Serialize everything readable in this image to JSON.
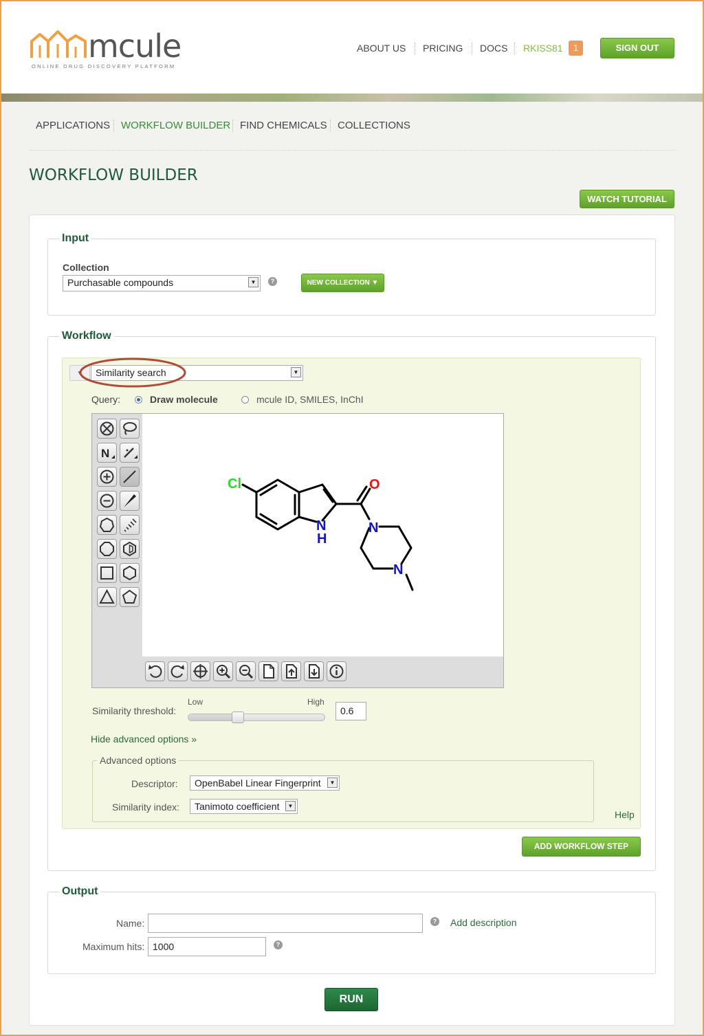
{
  "brand": {
    "name": "mcule",
    "tagline": "ONLINE DRUG DISCOVERY PLATFORM",
    "colors": {
      "accent_green": "#6ab536",
      "title_green": "#1f5a3a",
      "frame_orange": "#f0a040"
    }
  },
  "topnav": {
    "about": "ABOUT US",
    "pricing": "PRICING",
    "docs": "DOCS",
    "user": "RKISS81",
    "notifications": "1",
    "signout": "SIGN OUT"
  },
  "subnav": {
    "applications": "APPLICATIONS",
    "workflow_builder": "WORKFLOW BUILDER",
    "find_chemicals": "FIND CHEMICALS",
    "collections": "COLLECTIONS"
  },
  "page": {
    "title": "WORKFLOW BUILDER",
    "watch_tutorial": "WATCH TUTORIAL"
  },
  "input_section": {
    "legend": "Input",
    "collection_label": "Collection",
    "collection_value": "Purchasable compounds",
    "new_collection": "NEW COLLECTION ▼"
  },
  "workflow_section": {
    "legend": "Workflow",
    "step_value": "Similarity search",
    "query_label": "Query:",
    "query_draw": "Draw molecule",
    "query_text": "mcule ID, SMILES, InChI",
    "molecule_atoms": {
      "cl": "Cl",
      "o": "O",
      "nh_n": "N",
      "nh_h": "H",
      "n1": "N",
      "n2": "N"
    },
    "threshold_label": "Similarity threshold:",
    "threshold_low": "Low",
    "threshold_high": "High",
    "threshold_value": "0.6",
    "threshold_fraction": 0.35,
    "hide_advanced": "Hide advanced options »",
    "advanced_legend": "Advanced options",
    "descriptor_label": "Descriptor:",
    "descriptor_value": "OpenBabel Linear Fingerprint",
    "similarity_index_label": "Similarity index:",
    "similarity_index_value": "Tanimoto coefficient",
    "help": "Help",
    "add_step": "ADD WORKFLOW STEP"
  },
  "output_section": {
    "legend": "Output",
    "name_label": "Name:",
    "name_value": "",
    "add_description": "Add description",
    "max_hits_label": "Maximum hits:",
    "max_hits_value": "1000"
  },
  "run": "RUN"
}
